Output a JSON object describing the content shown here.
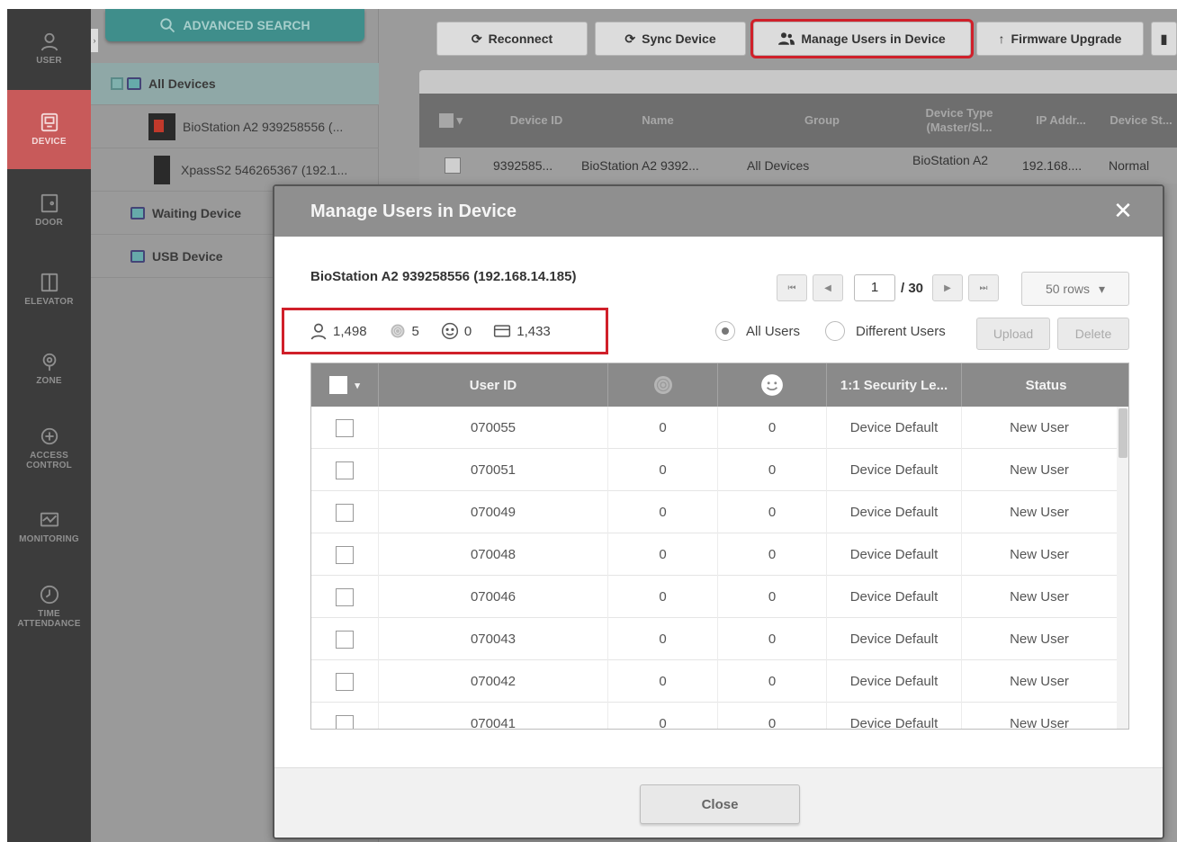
{
  "nav": [
    {
      "label": "USER",
      "icon": "user-icon"
    },
    {
      "label": "DEVICE",
      "icon": "device-icon",
      "active": true
    },
    {
      "label": "DOOR",
      "icon": "door-icon"
    },
    {
      "label": "ELEVATOR",
      "icon": "elevator-icon"
    },
    {
      "label": "ZONE",
      "icon": "zone-icon"
    },
    {
      "label": "ACCESS CONTROL",
      "icon": "access-control-icon"
    },
    {
      "label": "MONITORING",
      "icon": "monitoring-icon"
    },
    {
      "label": "TIME ATTENDANCE",
      "icon": "clock-icon"
    }
  ],
  "tree": {
    "search_label": "ADVANCED SEARCH",
    "all_devices": "All Devices",
    "device1": "BioStation A2 939258556 (...",
    "device2": "XpassS2 546265367 (192.1...",
    "waiting": "Waiting Device",
    "usb": "USB Device"
  },
  "toolbar": {
    "reconnect": "Reconnect",
    "sync": "Sync Device",
    "manage": "Manage Users in Device",
    "firmware": "Firmware Upgrade"
  },
  "grid": {
    "headers": [
      "Device ID",
      "Name",
      "Group",
      "Device Type (Master/Sl...",
      "IP Addr...",
      "Device St..."
    ],
    "row": {
      "id": "9392585...",
      "name": "BioStation A2 9392...",
      "group": "All Devices",
      "type": "BioStation A2",
      "ip": "192.168....",
      "status": "Normal"
    }
  },
  "modal": {
    "title": "Manage Users in Device",
    "device": "BioStation A2 939258556 (192.168.14.185)",
    "stats": {
      "users": "1,498",
      "fingerprints": "5",
      "faces": "0",
      "cards": "1,433"
    },
    "pager": {
      "page": "1",
      "total": "/ 30",
      "rows": "50 rows"
    },
    "filter_all": "All Users",
    "filter_diff": "Different Users",
    "upload": "Upload",
    "delete": "Delete",
    "columns": {
      "user_id": "User ID",
      "security": "1:1 Security Le...",
      "status": "Status"
    },
    "rows": [
      {
        "id": "070055",
        "fp": "0",
        "face": "0",
        "security": "Device Default",
        "status": "New User"
      },
      {
        "id": "070051",
        "fp": "0",
        "face": "0",
        "security": "Device Default",
        "status": "New User"
      },
      {
        "id": "070049",
        "fp": "0",
        "face": "0",
        "security": "Device Default",
        "status": "New User"
      },
      {
        "id": "070048",
        "fp": "0",
        "face": "0",
        "security": "Device Default",
        "status": "New User"
      },
      {
        "id": "070046",
        "fp": "0",
        "face": "0",
        "security": "Device Default",
        "status": "New User"
      },
      {
        "id": "070043",
        "fp": "0",
        "face": "0",
        "security": "Device Default",
        "status": "New User"
      },
      {
        "id": "070042",
        "fp": "0",
        "face": "0",
        "security": "Device Default",
        "status": "New User"
      },
      {
        "id": "070041",
        "fp": "0",
        "face": "0",
        "security": "Device Default",
        "status": "New User"
      }
    ],
    "close": "Close"
  },
  "colors": {
    "rail": "#3c3c3c",
    "active": "#c85a5a",
    "accent": "#3f8e8b",
    "highlight": "#d0202a"
  }
}
